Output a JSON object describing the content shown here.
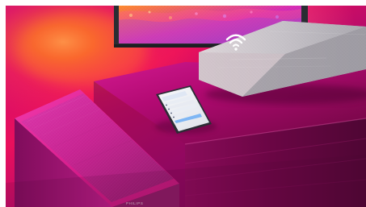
{
  "scene": {
    "brand_text": "PHILIPS",
    "phone_app_title": "",
    "colors": {
      "magenta": "#b1086d",
      "deep_magenta": "#61063a",
      "red_glow": "#ff2c2c",
      "orange_glow": "#ff8b1f",
      "soundbar_gray": "#b4b4b8",
      "subwoofer_pink": "#ea1fa4",
      "phone_screen": "#f3f3f6"
    }
  }
}
